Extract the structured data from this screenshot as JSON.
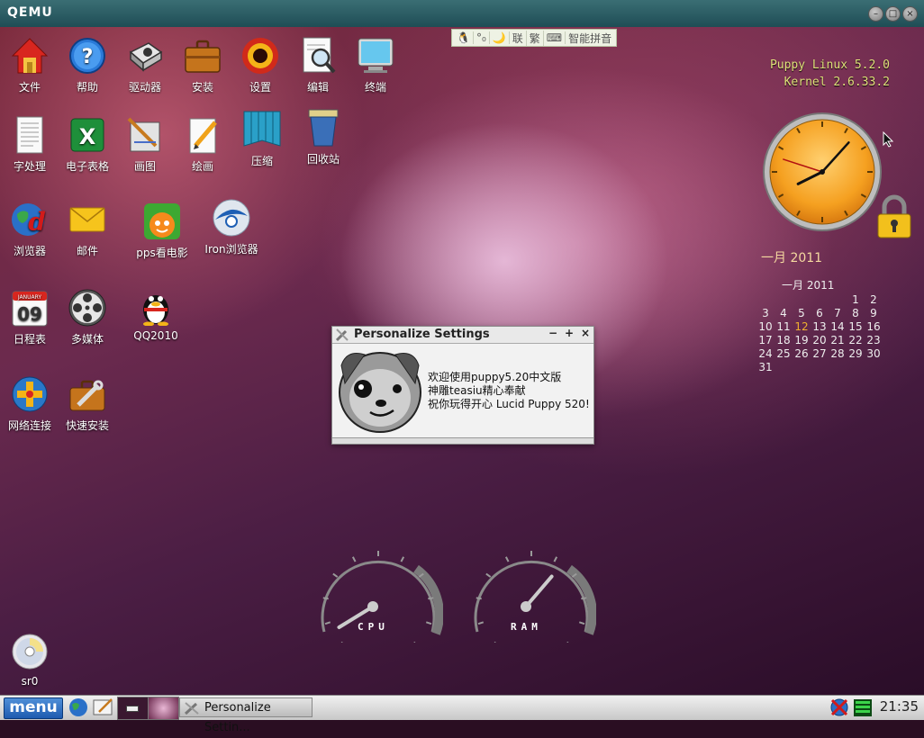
{
  "window": {
    "title": "QEMU"
  },
  "ime_bar": {
    "items": [
      "🐧",
      "°₀",
      "🌙",
      "|",
      "联",
      "繁",
      "|",
      "⌨",
      "智能拼音"
    ]
  },
  "desktop_icons": [
    {
      "label": "文件",
      "icon": "home-icon"
    },
    {
      "label": "帮助",
      "icon": "help-icon"
    },
    {
      "label": "驱动器",
      "icon": "drive-icon"
    },
    {
      "label": "安装",
      "icon": "briefcase-icon"
    },
    {
      "label": "设置",
      "icon": "settings-icon"
    },
    {
      "label": "编辑",
      "icon": "edit-icon"
    },
    {
      "label": "终端",
      "icon": "terminal-icon"
    },
    {
      "label": "字处理",
      "icon": "wordprocessor-icon"
    },
    {
      "label": "电子表格",
      "icon": "spreadsheet-icon"
    },
    {
      "label": "画图",
      "icon": "draw-icon"
    },
    {
      "label": "绘画",
      "icon": "paint-icon"
    },
    {
      "label": "压缩",
      "icon": "archive-icon"
    },
    {
      "label": "回收站",
      "icon": "trash-icon"
    },
    {
      "label": "浏览器",
      "icon": "browser-icon"
    },
    {
      "label": "邮件",
      "icon": "mail-icon"
    },
    {
      "label": "pps看电影",
      "icon": "pps-icon"
    },
    {
      "label": "Iron浏览器",
      "icon": "iron-browser-icon"
    },
    {
      "label": "日程表",
      "icon": "calendar-icon"
    },
    {
      "label": "多媒体",
      "icon": "multimedia-icon"
    },
    {
      "label": "QQ2010",
      "icon": "qq-icon"
    },
    {
      "label": "网络连接",
      "icon": "network-icon"
    },
    {
      "label": "快速安装",
      "icon": "quick-install-icon"
    },
    {
      "label": "sr0",
      "icon": "cdrom-icon"
    }
  ],
  "calendar_icon_text": {
    "month": "JANUARY",
    "day": "09"
  },
  "sysinfo": {
    "line1": "Puppy Linux 5.2.0",
    "line2": "Kernel 2.6.33.2"
  },
  "month_display": "一月  2011",
  "calendar": {
    "title": "一月 2011",
    "today": 12,
    "rows": [
      [
        "",
        "",
        "",
        "",
        "",
        "1",
        "2"
      ],
      [
        "3",
        "4",
        "5",
        "6",
        "7",
        "8",
        "9"
      ],
      [
        "10",
        "11",
        "12",
        "13",
        "14",
        "15",
        "16"
      ],
      [
        "17",
        "18",
        "19",
        "20",
        "21",
        "22",
        "23"
      ],
      [
        "24",
        "25",
        "26",
        "27",
        "28",
        "29",
        "30"
      ],
      [
        "31",
        "",
        "",
        "",
        "",
        "",
        ""
      ]
    ]
  },
  "clock": {
    "hour": 8,
    "minute": 7,
    "second": 48
  },
  "dialog": {
    "title": "Personalize Settings",
    "buttons": [
      "−",
      "+",
      "×"
    ],
    "lines": [
      "欢迎使用puppy5.20中文版",
      "神雕teasiu精心奉献",
      "祝你玩得开心 Lucid Puppy 520!"
    ]
  },
  "gauges": {
    "cpu_label": "CPU",
    "ram_label": "RAM",
    "cpu_level": 0.05,
    "ram_level": 0.65
  },
  "taskbar": {
    "menu_label": "menu",
    "task_label": "Personalize Settin...",
    "time": "21:35"
  },
  "colors": {
    "accent": "#1e5bb0",
    "clock_face": "#f5a623",
    "today": "#f0b030"
  }
}
